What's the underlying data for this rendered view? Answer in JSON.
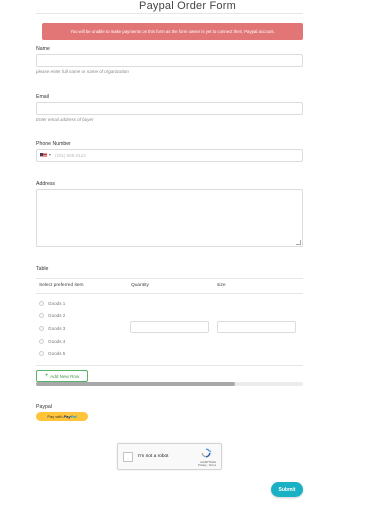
{
  "form": {
    "title": "Paypal Order Form",
    "alert": "You will be unable to make payments on this form as the form owner is yet to connect their, Paypal account."
  },
  "fields": {
    "name": {
      "label": "Name",
      "help": "please enter full name or name of organization"
    },
    "email": {
      "label": "Email",
      "help": "Enter email address of buyer"
    },
    "phone": {
      "label": "Phone Number",
      "placeholder": "(201) 555-0123",
      "country_icon": "us-flag-icon",
      "caret": "▾"
    },
    "address": {
      "label": "Address"
    }
  },
  "table": {
    "label": "Table",
    "headers": [
      "Select preferred item",
      "Quantity",
      "size"
    ],
    "options": [
      "Goods 1",
      "Goods 2",
      "Goods 3",
      "Goods 4",
      "Goods 5"
    ],
    "add_row_label": "Add New Row",
    "add_row_icon": "+"
  },
  "paypal": {
    "label": "Paypal",
    "button_prefix": "Pay with",
    "brand_pay": "Pay",
    "brand_pal": "Pal"
  },
  "captcha": {
    "label": "I'm not a robot",
    "brand": "reCAPTCHA",
    "links": "Privacy - Terms"
  },
  "submit_label": "Submit",
  "colors": {
    "alert_bg": "#e27576",
    "add_row": "#3a9a4d",
    "paypal_btn": "#ffc439",
    "submit_bg": "#1ab1c4"
  }
}
